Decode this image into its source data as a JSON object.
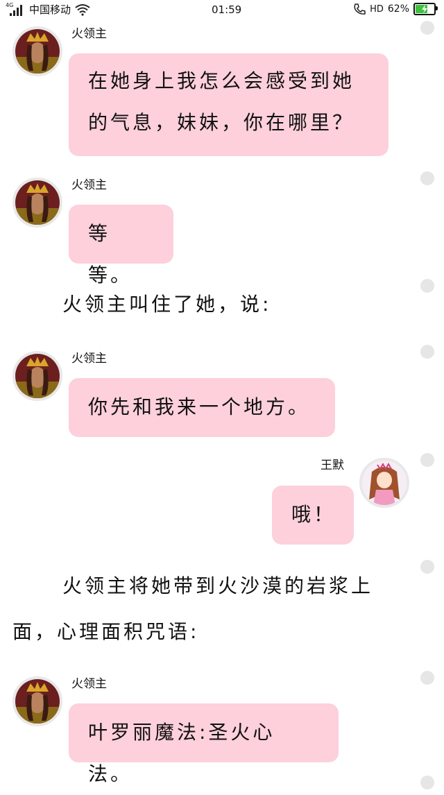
{
  "status_bar": {
    "network": "4G",
    "carrier": "中国移动",
    "time": "01:59",
    "hd": "HD",
    "battery_percent": "62%",
    "battery_level": 0.62,
    "battery_color": "#3cc23c"
  },
  "colors": {
    "bubble": "#fdd0db",
    "dot": "#e6e6e6"
  },
  "messages": [
    {
      "type": "bubble",
      "sender": "火领主",
      "side": "left",
      "lines": [
        "在她身上我怎么会感受到她",
        "的气息，妹妹，你在哪里？"
      ]
    },
    {
      "type": "bubble",
      "sender": "火领主",
      "side": "left",
      "lines": [
        "等等。"
      ]
    },
    {
      "type": "narration",
      "lines": [
        "火领主叫住了她，说:"
      ]
    },
    {
      "type": "bubble",
      "sender": "火领主",
      "side": "left",
      "lines": [
        "你先和我来一个地方。"
      ]
    },
    {
      "type": "bubble",
      "sender": "王默",
      "side": "right",
      "lines": [
        "哦！"
      ]
    },
    {
      "type": "narration",
      "lines": [
        "火领主将她带到火沙漠的岩浆上",
        "面，心理面积咒语:"
      ]
    },
    {
      "type": "bubble",
      "sender": "火领主",
      "side": "left",
      "lines": [
        "叶罗丽魔法:圣火心法。"
      ]
    }
  ]
}
